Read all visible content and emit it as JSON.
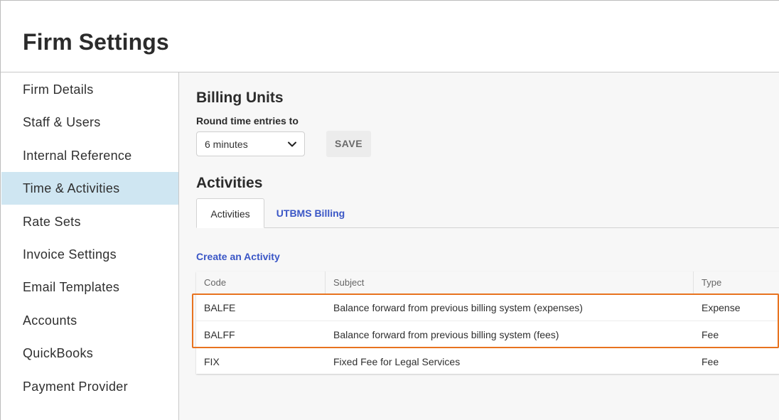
{
  "page": {
    "title": "Firm Settings"
  },
  "sidebar": {
    "items": [
      {
        "label": "Firm Details"
      },
      {
        "label": "Staff & Users"
      },
      {
        "label": "Internal Reference"
      },
      {
        "label": "Time & Activities",
        "active": true
      },
      {
        "label": "Rate Sets"
      },
      {
        "label": "Invoice Settings"
      },
      {
        "label": "Email Templates"
      },
      {
        "label": "Accounts"
      },
      {
        "label": "QuickBooks"
      },
      {
        "label": "Payment Provider"
      }
    ]
  },
  "billing_units": {
    "heading": "Billing Units",
    "round_label": "Round time entries to",
    "round_value": "6 minutes",
    "save_label": "SAVE"
  },
  "activities": {
    "heading": "Activities",
    "tabs": [
      {
        "label": "Activities",
        "active": true
      },
      {
        "label": "UTBMS Billing",
        "active": false
      }
    ],
    "create_link": "Create an Activity",
    "columns": [
      "Code",
      "Subject",
      "Type"
    ],
    "rows": [
      {
        "code": "BALFE",
        "subject": "Balance forward from previous billing system (expenses)",
        "type": "Expense"
      },
      {
        "code": "BALFF",
        "subject": "Balance forward from previous billing system (fees)",
        "type": "Fee"
      },
      {
        "code": "FIX",
        "subject": "Fixed Fee for Legal Services",
        "type": "Fee"
      }
    ]
  },
  "icons": {
    "select_chevron": "chevron-down-icon"
  },
  "colors": {
    "active_nav_bg": "#cfe6f2",
    "link": "#3a56c6",
    "highlight_outline": "#e8731f"
  }
}
